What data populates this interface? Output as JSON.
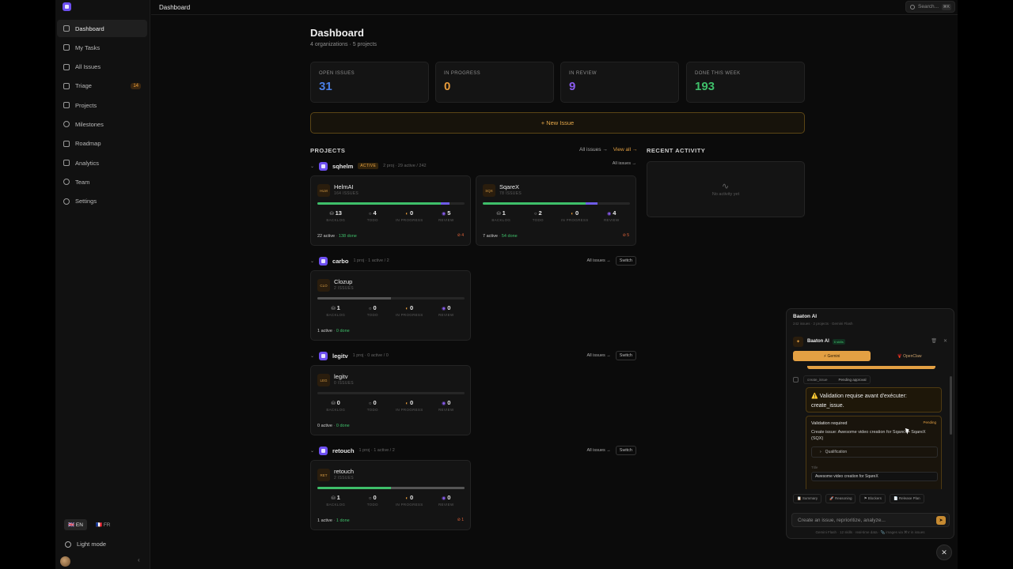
{
  "nav": {
    "items": [
      {
        "label": "Dashboard",
        "icon": "grid-icon"
      },
      {
        "label": "My Tasks",
        "icon": "check-icon"
      },
      {
        "label": "All Issues",
        "icon": "layers-icon"
      },
      {
        "label": "Triage",
        "icon": "inbox-icon",
        "badge": "14"
      },
      {
        "label": "Projects",
        "icon": "folder-icon"
      },
      {
        "label": "Milestones",
        "icon": "target-icon"
      },
      {
        "label": "Roadmap",
        "icon": "calendar-icon"
      },
      {
        "label": "Analytics",
        "icon": "chart-icon"
      },
      {
        "label": "Team",
        "icon": "users-icon"
      },
      {
        "label": "Settings",
        "icon": "gear-icon"
      }
    ],
    "lang_en": "🇬🇧 EN",
    "lang_fr": "🇫🇷 FR",
    "light_mode": "Light mode",
    "collapse": "‹"
  },
  "topbar": {
    "breadcrumb": "Dashboard",
    "search_placeholder": "Search...",
    "search_kbd": "⌘K"
  },
  "dashboard": {
    "title": "Dashboard",
    "subtitle": "4 organizations · 5 projects",
    "stats": [
      {
        "label": "OPEN ISSUES",
        "value": "31",
        "color": "#4a7fe6"
      },
      {
        "label": "IN PROGRESS",
        "value": "0",
        "color": "#e69a3a"
      },
      {
        "label": "IN REVIEW",
        "value": "9",
        "color": "#8a5cf0"
      },
      {
        "label": "DONE THIS WEEK",
        "value": "193",
        "color": "#3fbf6a"
      }
    ],
    "new_issue": "+ New Issue",
    "projects_heading": "PROJECTS",
    "all_issues_link": "All issues →",
    "view_all_link": "View all →",
    "recent_heading": "RECENT ACTIVITY",
    "no_activity": "No activity yet"
  },
  "orgs": [
    {
      "name": "sqhelm",
      "active": "ACTIVE",
      "meta": "2 proj · 29 active / 242",
      "right_link": "All issues →",
      "switch": "",
      "projects": [
        {
          "code": "HLM",
          "name": "HelmAI",
          "issues": "164 ISSUES",
          "bar": [
            {
              "pct": 84,
              "color": "#3fbf6a"
            },
            {
              "pct": 6,
              "color": "#6e5ce8"
            }
          ],
          "counts": [
            {
              "glyph": "⛁",
              "n": "13",
              "label": "BACKLOG",
              "color": "#aaa"
            },
            {
              "glyph": "○",
              "n": "4",
              "label": "TODO",
              "color": "#aaa"
            },
            {
              "glyph": "◐",
              "n": "0",
              "label": "IN PROGRESS",
              "color": "#e69a3a"
            },
            {
              "glyph": "◉",
              "n": "5",
              "label": "REVIEW",
              "color": "#8a5cf0"
            }
          ],
          "active_count": "22 active",
          "done_count": "138 done",
          "warn": "⊘ 4"
        },
        {
          "code": "SQX",
          "name": "SqareX",
          "issues": "78 ISSUES",
          "bar": [
            {
              "pct": 70,
              "color": "#3fbf6a"
            },
            {
              "pct": 8,
              "color": "#6e5ce8"
            }
          ],
          "counts": [
            {
              "glyph": "⛁",
              "n": "1",
              "label": "BACKLOG",
              "color": "#aaa"
            },
            {
              "glyph": "○",
              "n": "2",
              "label": "TODO",
              "color": "#aaa"
            },
            {
              "glyph": "◐",
              "n": "0",
              "label": "IN PROGRESS",
              "color": "#e69a3a"
            },
            {
              "glyph": "◉",
              "n": "4",
              "label": "REVIEW",
              "color": "#8a5cf0"
            }
          ],
          "active_count": "7 active",
          "done_count": "54 done",
          "warn": "⊘ 5"
        }
      ]
    },
    {
      "name": "carbo",
      "active": "",
      "meta": "1 proj · 1 active / 2",
      "right_link": "All issues →",
      "switch": "Switch",
      "projects": [
        {
          "code": "CLO",
          "name": "Clozup",
          "issues": "2 ISSUES",
          "bar": [
            {
              "pct": 50,
              "color": "#555"
            }
          ],
          "counts": [
            {
              "glyph": "⛁",
              "n": "1",
              "label": "BACKLOG",
              "color": "#aaa"
            },
            {
              "glyph": "○",
              "n": "0",
              "label": "TODO",
              "color": "#aaa"
            },
            {
              "glyph": "◐",
              "n": "0",
              "label": "IN PROGRESS",
              "color": "#e69a3a"
            },
            {
              "glyph": "◉",
              "n": "0",
              "label": "REVIEW",
              "color": "#8a5cf0"
            }
          ],
          "active_count": "1 active",
          "done_count": "0 done",
          "warn": ""
        }
      ]
    },
    {
      "name": "legitv",
      "active": "",
      "meta": "1 proj · 0 active / 0",
      "right_link": "All issues →",
      "switch": "Switch",
      "projects": [
        {
          "code": "LEG",
          "name": "legitv",
          "issues": "0 ISSUES",
          "bar": [],
          "counts": [
            {
              "glyph": "⛁",
              "n": "0",
              "label": "BACKLOG",
              "color": "#aaa"
            },
            {
              "glyph": "○",
              "n": "0",
              "label": "TODO",
              "color": "#aaa"
            },
            {
              "glyph": "◐",
              "n": "0",
              "label": "IN PROGRESS",
              "color": "#e69a3a"
            },
            {
              "glyph": "◉",
              "n": "0",
              "label": "REVIEW",
              "color": "#8a5cf0"
            }
          ],
          "active_count": "0 active",
          "done_count": "0 done",
          "warn": ""
        }
      ]
    },
    {
      "name": "retouch",
      "active": "",
      "meta": "1 proj · 1 active / 2",
      "right_link": "All issues →",
      "switch": "Switch",
      "projects": [
        {
          "code": "RET",
          "name": "retouch",
          "issues": "2 ISSUES",
          "bar": [
            {
              "pct": 50,
              "color": "#3fbf6a"
            },
            {
              "pct": 50,
              "color": "#555"
            }
          ],
          "counts": [
            {
              "glyph": "⛁",
              "n": "1",
              "label": "BACKLOG",
              "color": "#aaa"
            },
            {
              "glyph": "○",
              "n": "0",
              "label": "TODO",
              "color": "#aaa"
            },
            {
              "glyph": "◐",
              "n": "0",
              "label": "IN PROGRESS",
              "color": "#e69a3a"
            },
            {
              "glyph": "◉",
              "n": "0",
              "label": "REVIEW",
              "color": "#8a5cf0"
            }
          ],
          "active_count": "1 active",
          "done_count": "1 done",
          "warn": "⊘ 1"
        }
      ]
    }
  ],
  "chat": {
    "title": "Baaton AI",
    "subtitle": "242 issues · 2 projects · Gemini Flash",
    "bot_name": "Baaton AI",
    "skills": "6 skills",
    "tab_gemini": "⚡ Gemini",
    "tab_openclaw": "🦞 OpenClaw",
    "tool_name": "create_issue",
    "tool_status": "Pending approval",
    "validation_msg": "⚠️ Validation requise avant d'exécuter: create_issue.",
    "req_title": "Validation required",
    "req_status": "Pending",
    "req_desc": "Create issue: Awesome video creation for SqareX • SqareX (SQX)",
    "qualification": "Qualification",
    "field_label": "Title",
    "field_value": "Awesome video creation for SqareX",
    "chips": [
      "📋 Summary",
      "🚀 Reasoning",
      "⚑ Blockers",
      "📄 Release Plan"
    ],
    "input_placeholder": "Create an issue, reprioritize, analyze...",
    "footnote": "Gemini Flash · 12 skills · real-time data · 📎 images via ⌘V in issues",
    "close": "✕"
  }
}
